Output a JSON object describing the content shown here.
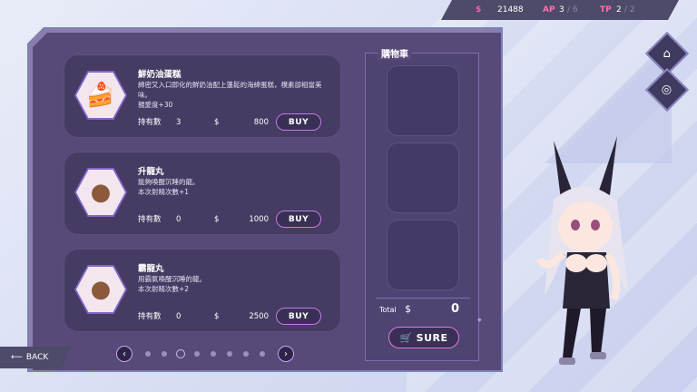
{
  "stats": {
    "money_icon": "$",
    "money": "21488",
    "ap_label": "AP",
    "ap": "3",
    "ap_max": "/ 6",
    "tp_label": "TP",
    "tp": "2",
    "tp_max": "/ 2"
  },
  "items": [
    {
      "name": "鮮奶油蛋糕",
      "desc": "綿密又入口即化的鮮奶油配上蓬鬆的海綿蛋糕，樸素卻相當美味。\n親愛度+30",
      "qty_label": "持有數",
      "qty": "3",
      "dollar": "$",
      "price": "800",
      "buy": "BUY",
      "icon": "cake-icon"
    },
    {
      "name": "升龍丸",
      "desc": "能夠喚醒沉睡的龍。\n本次射精次數+1",
      "qty_label": "持有數",
      "qty": "0",
      "dollar": "$",
      "price": "1000",
      "buy": "BUY",
      "icon": "pill-icon"
    },
    {
      "name": "霸龍丸",
      "desc": "用霸氣喚醒沉睡的龍。\n本次射精次數+2",
      "qty_label": "持有數",
      "qty": "0",
      "dollar": "$",
      "price": "2500",
      "buy": "BUY",
      "icon": "pill-icon"
    }
  ],
  "pager": {
    "prev": "‹",
    "next": "›",
    "pages": 8,
    "active": 2
  },
  "cart": {
    "title": "購物車",
    "total_label": "Total",
    "dollar": "$",
    "total": "0",
    "sure": "SURE"
  },
  "back": {
    "label": "BACK"
  },
  "side": {
    "shop_icon": "shop-icon",
    "gallery_icon": "gallery-icon"
  },
  "colors": {
    "accent": "#c07ce8",
    "panel": "#574a78",
    "card": "#463b63"
  }
}
